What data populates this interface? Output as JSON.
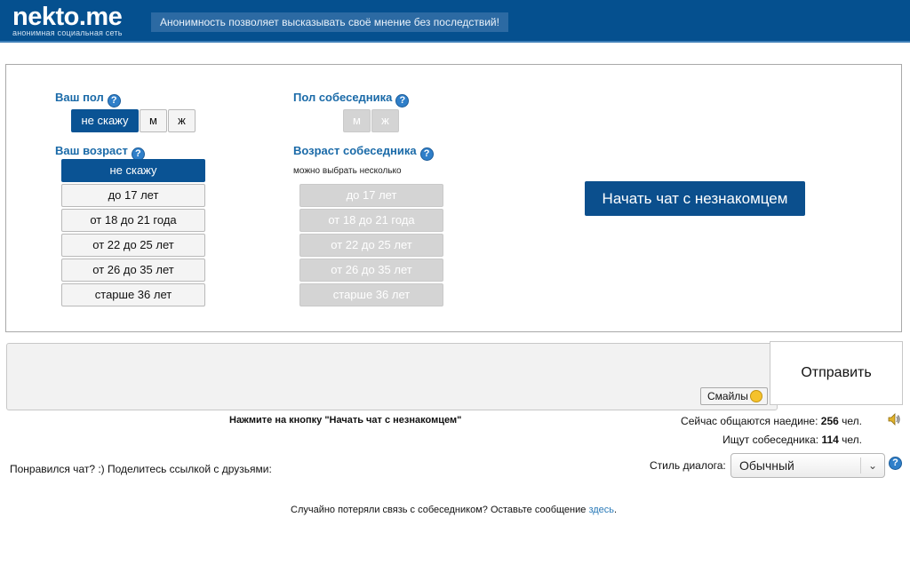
{
  "header": {
    "logo": "nekto.me",
    "logo_subtitle": "анонимная социальная сеть",
    "slogan": "Анонимность позволяет высказывать своё мнение без последствий!"
  },
  "settings": {
    "your_gender": {
      "label": "Ваш пол",
      "options": [
        "не скажу",
        "м",
        "ж"
      ],
      "selected": "не скажу"
    },
    "partner_gender": {
      "label": "Пол собеседника",
      "options": [
        "м",
        "ж"
      ]
    },
    "your_age": {
      "label": "Ваш возраст",
      "options": [
        "не скажу",
        "до 17 лет",
        "от 18 до 21 года",
        "от 22 до 25 лет",
        "от 26 до 35 лет",
        "старше 36 лет"
      ],
      "selected": "не скажу"
    },
    "partner_age": {
      "label": "Возраст собеседника",
      "hint": "можно выбрать несколько",
      "options": [
        "до 17 лет",
        "от 18 до 21 года",
        "от 22 до 25 лет",
        "от 26 до 35 лет",
        "старше 36 лет"
      ]
    },
    "help_glyph": "?",
    "start_button": "Начать чат с незнакомцем"
  },
  "composer": {
    "message_value": "",
    "smiles_label": "Смайлы",
    "send_label": "Отправить"
  },
  "status": {
    "instruction": "Нажмите на кнопку \"Начать чат с незнакомцем\"",
    "chatting_prefix": "Сейчас общаются наедине: ",
    "chatting_count": "256",
    "chatting_suffix": " чел.",
    "searching_prefix": "Ищут собеседника: ",
    "searching_count": "114",
    "searching_suffix": " чел."
  },
  "share": {
    "text": "Понравился чат? :) Поделитесь ссылкой с друзьями:"
  },
  "dialog_style": {
    "label": "Стиль диалога:",
    "selected": "Обычный"
  },
  "footer": {
    "text": "Случайно потеряли связь с собеседником? Оставьте сообщение ",
    "link": "здесь",
    "end": "."
  },
  "colors": {
    "brand": "#05508f",
    "active_button": "#0a5394",
    "label": "#1a6aa8",
    "disabled": "#d4d4d4"
  },
  "icons": [
    "help-icon",
    "smile-icon",
    "speaker-icon",
    "chevron-down-icon"
  ]
}
